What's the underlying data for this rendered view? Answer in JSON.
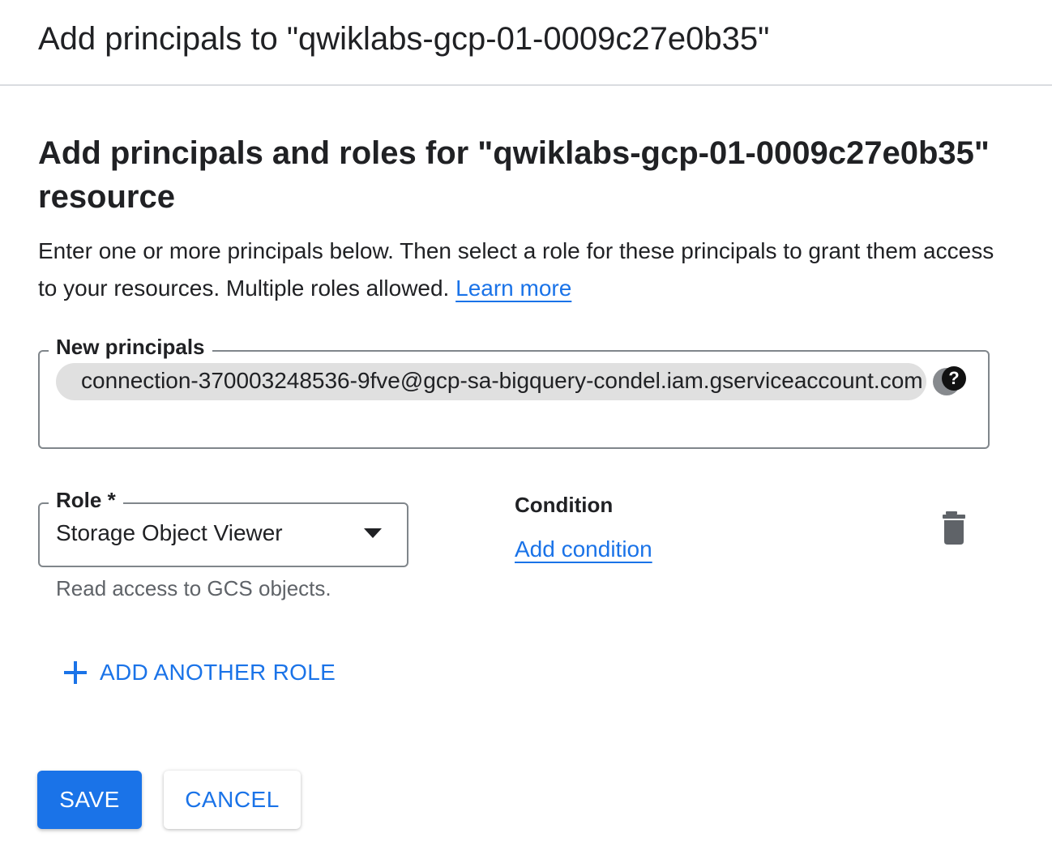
{
  "panel": {
    "title": "Add principals to \"qwiklabs-gcp-01-0009c27e0b35\""
  },
  "section": {
    "heading": "Add principals and roles for \"qwiklabs-gcp-01-0009c27e0b35\" resource",
    "description": "Enter one or more principals below. Then select a role for these principals to grant them access to your resources. Multiple roles allowed.",
    "learn_more_label": "Learn more"
  },
  "principals": {
    "label": "New principals",
    "chips": [
      "connection-370003248536-9fve@gcp-sa-bigquery-condel.iam.gserviceaccount.com"
    ],
    "help_icon": "help-circle-icon",
    "help_glyph": "?"
  },
  "role": {
    "label": "Role *",
    "selected": "Storage Object Viewer",
    "hint": "Read access to GCS objects.",
    "dropdown_icon": "arrow-drop-down-icon"
  },
  "condition": {
    "heading": "Condition",
    "add_label": "Add condition"
  },
  "actions": {
    "delete_icon": "trash-icon",
    "add_role_label": "ADD ANOTHER ROLE",
    "save_label": "SAVE",
    "cancel_label": "CANCEL"
  },
  "colors": {
    "accent": "#1a73e8",
    "text": "#202124",
    "muted": "#5f6368",
    "chip": "#e0e0e0",
    "border": "#80868b"
  }
}
